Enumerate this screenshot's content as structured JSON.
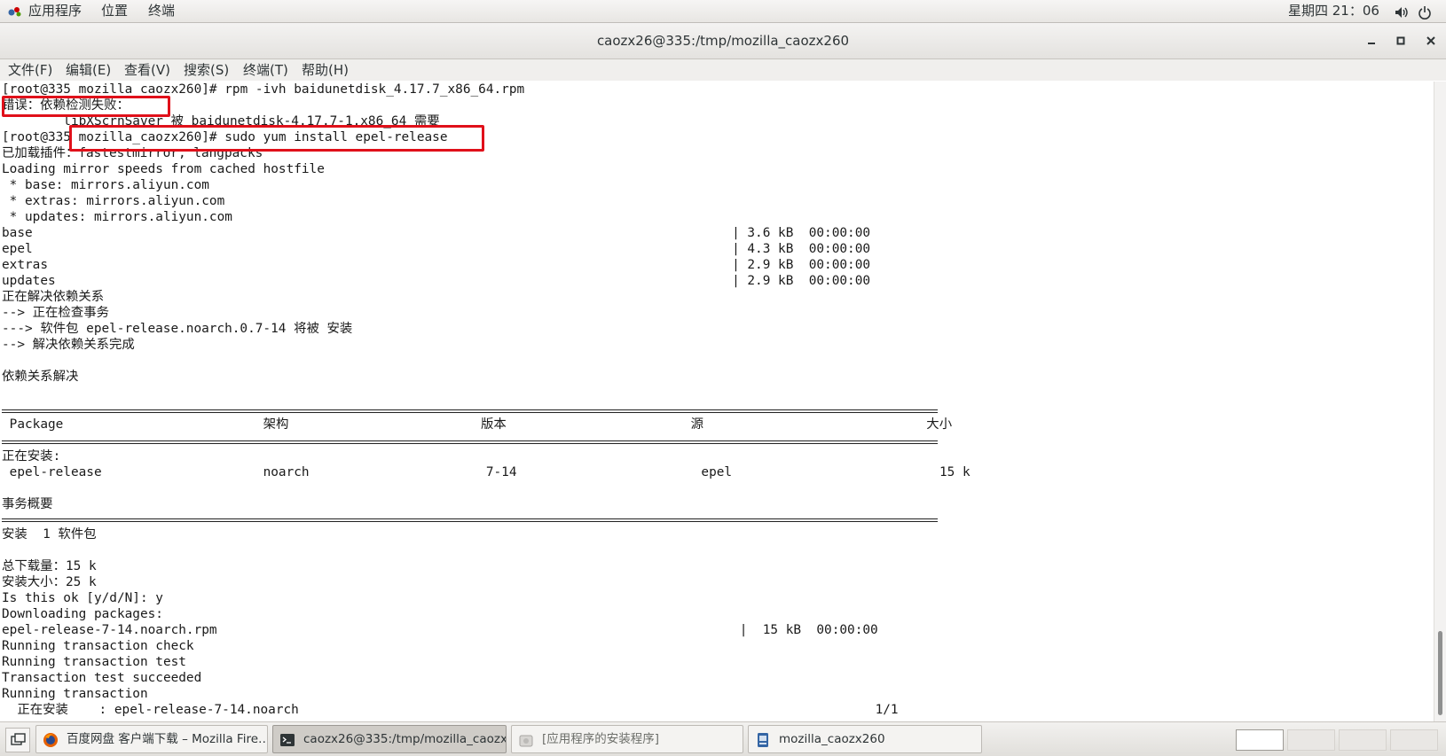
{
  "top_panel": {
    "apps_label": "应用程序",
    "places_label": "位置",
    "terminal_label": "终端",
    "clock": "星期四 21：06",
    "apps_icon": "gnome-foot-icon",
    "volume_icon": "volume-icon",
    "power_icon": "power-icon"
  },
  "window": {
    "title": "caozx26@335:/tmp/mozilla_caozx260",
    "min_icon": "minimize-icon",
    "max_icon": "maximize-icon",
    "close_icon": "close-icon"
  },
  "menu": [
    {
      "label": "文件(F)"
    },
    {
      "label": "编辑(E)"
    },
    {
      "label": "查看(V)"
    },
    {
      "label": "搜索(S)"
    },
    {
      "label": "终端(T)"
    },
    {
      "label": "帮助(H)"
    }
  ],
  "terminal": {
    "lines": [
      "[root@335 mozilla_caozx260]# rpm -ivh baidunetdisk_4.17.7_x86_64.rpm",
      "错误：依赖检测失败：",
      "        libXScrnSaver 被 baidunetdisk-4.17.7-1.x86_64 需要",
      "[root@335 mozilla_caozx260]# sudo yum install epel-release",
      "已加载插件：fastestmirror, langpacks",
      "Loading mirror speeds from cached hostfile",
      " * base: mirrors.aliyun.com",
      " * extras: mirrors.aliyun.com",
      " * updates: mirrors.aliyun.com",
      "base                                                                                           | 3.6 kB  00:00:00",
      "epel                                                                                           | 4.3 kB  00:00:00",
      "extras                                                                                         | 2.9 kB  00:00:00",
      "updates                                                                                        | 2.9 kB  00:00:00",
      "正在解决依赖关系",
      "--> 正在检查事务",
      "---> 软件包 epel-release.noarch.0.7-14 将被 安装",
      "--> 解决依赖关系完成",
      "",
      "依赖关系解决",
      "",
      "",
      "",
      " Package                          架构                         版本                        源                             大小",
      "",
      "",
      "正在安装:",
      " epel-release                     noarch                       7-14                        epel                           15 k",
      "",
      "事务概要",
      "",
      "",
      "安装  1 软件包",
      "",
      "总下载量：15 k",
      "安装大小：25 k",
      "Is this ok [y/d/N]: y",
      "Downloading packages:",
      "epel-release-7-14.noarch.rpm                                                                    |  15 kB  00:00:00",
      "Running transaction check",
      "Running transaction test",
      "Transaction test succeeded",
      "Running transaction",
      "  正在安装    : epel-release-7-14.noarch                                                                           1/1"
    ]
  },
  "taskbar": {
    "show_desktop_icon": "show-desktop-icon",
    "tasks": [
      {
        "label": "百度网盘 客户端下载 – Mozilla Fire…",
        "icon": "firefox-icon"
      },
      {
        "label": "caozx26@335:/tmp/mozilla_caozx2…",
        "icon": "terminal-icon"
      },
      {
        "label": "[应用程序的安装程序]",
        "icon": "software-installer-icon"
      },
      {
        "label": "mozilla_caozx260",
        "icon": "file-manager-icon"
      }
    ],
    "workspaces": [
      "1",
      "2",
      "3",
      "4"
    ]
  },
  "annotation_color": "#e0101a"
}
